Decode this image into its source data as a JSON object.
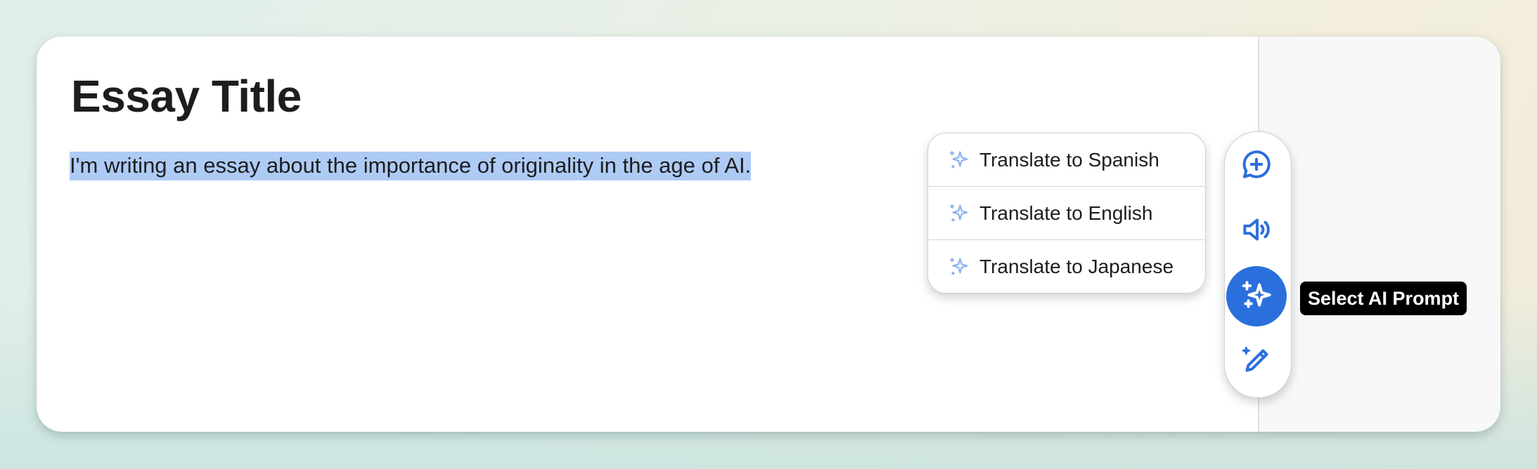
{
  "editor": {
    "title": "Essay Title",
    "body_text": "I'm writing an essay about the importance of originality in the age of AI."
  },
  "prompt_menu": {
    "items": [
      {
        "label": "Translate to Spanish",
        "icon": "sparkle-icon"
      },
      {
        "label": "Translate to English",
        "icon": "sparkle-icon"
      },
      {
        "label": "Translate to Japanese",
        "icon": "sparkle-icon"
      }
    ]
  },
  "toolbar": {
    "buttons": [
      {
        "name": "add-comment",
        "icon": "chat-plus-icon",
        "active": false
      },
      {
        "name": "read-aloud",
        "icon": "speaker-icon",
        "active": false
      },
      {
        "name": "ai-prompt",
        "icon": "sparkles-icon",
        "active": true
      },
      {
        "name": "ai-edit",
        "icon": "pencil-sparkle-icon",
        "active": false
      }
    ]
  },
  "tooltip": {
    "text": "Select AI Prompt"
  },
  "colors": {
    "accent": "#2b6fdc",
    "selection": "#aecbf5",
    "menu_icon": "#8fb2ef",
    "text": "#1d1d1f"
  }
}
